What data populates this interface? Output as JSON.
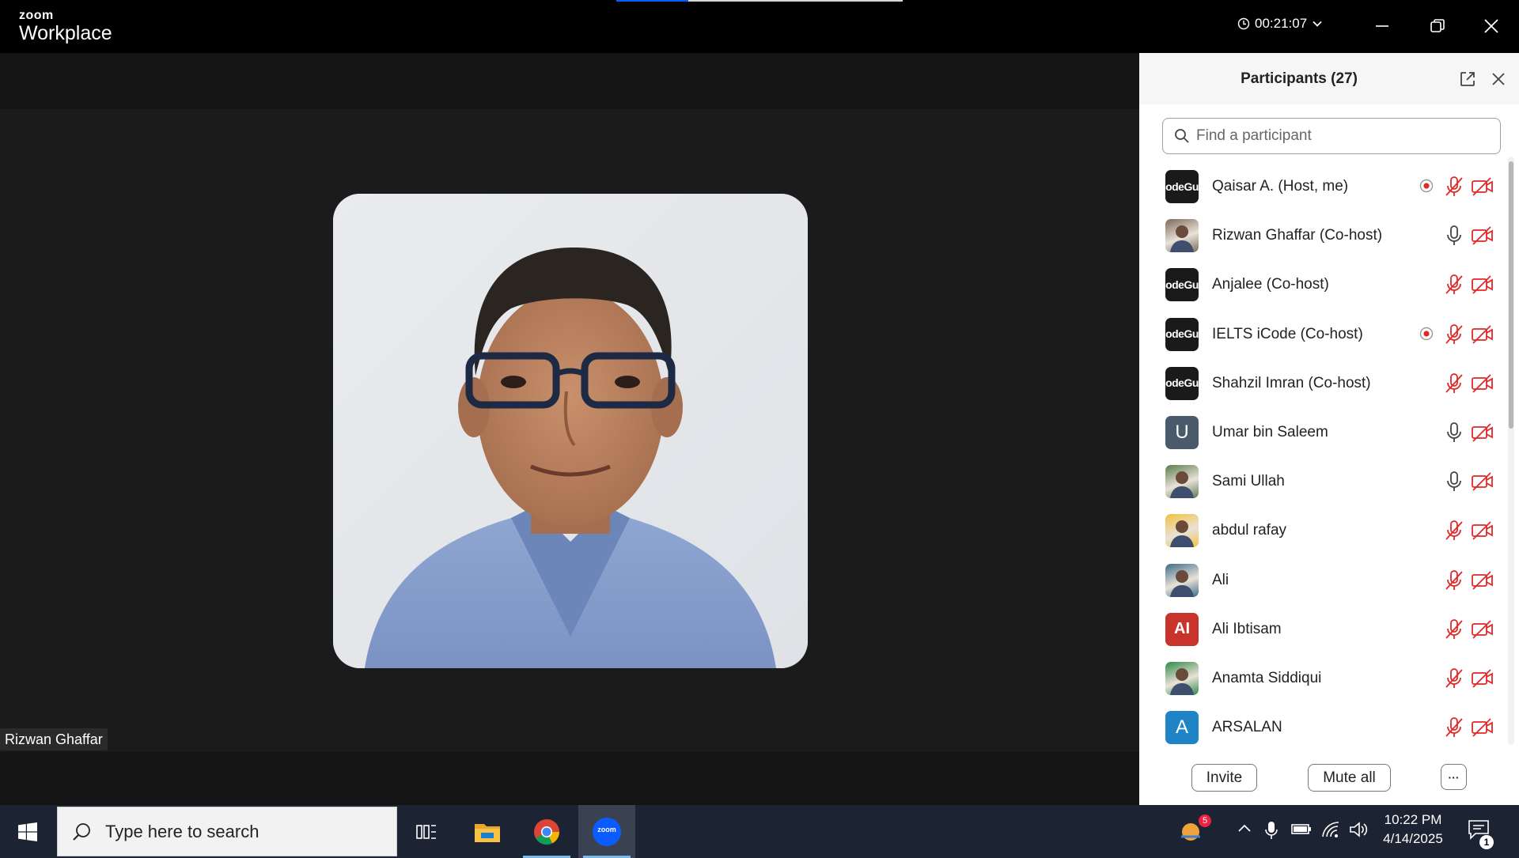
{
  "titlebar": {
    "brand_small": "zoom",
    "brand_big": "Workplace",
    "timer": "00:21:07",
    "share_progress": 0.25,
    "icons": [
      "clock-icon",
      "chevron-down-icon",
      "minimize-icon",
      "restore-icon",
      "close-icon"
    ]
  },
  "video": {
    "active_speaker": "Rizwan Ghaffar"
  },
  "panel": {
    "title": "Participants (27)",
    "search_placeholder": "Find a participant",
    "participants": [
      {
        "name": "Qaisar A. (Host, me)",
        "avatar": "codeguru",
        "recording": true,
        "mic": "muted",
        "camera": "off"
      },
      {
        "name": "Rizwan Ghaffar (Co-host)",
        "avatar": "photo",
        "recording": false,
        "mic": "on",
        "camera": "off"
      },
      {
        "name": "Anjalee (Co-host)",
        "avatar": "codeguru",
        "recording": false,
        "mic": "muted",
        "camera": "off"
      },
      {
        "name": "IELTS iCode (Co-host)",
        "avatar": "codeguru",
        "recording": true,
        "mic": "muted",
        "camera": "off"
      },
      {
        "name": "Shahzil Imran (Co-host)",
        "avatar": "codeguru",
        "recording": false,
        "mic": "muted",
        "camera": "off"
      },
      {
        "name": "Umar bin Saleem",
        "avatar": "U",
        "avatar_color": "#4a5a6a",
        "recording": false,
        "mic": "on",
        "camera": "off"
      },
      {
        "name": "Sami Ullah",
        "avatar": "photo",
        "recording": false,
        "mic": "on",
        "camera": "off"
      },
      {
        "name": "abdul rafay",
        "avatar": "photo",
        "recording": false,
        "mic": "muted",
        "camera": "off"
      },
      {
        "name": "Ali",
        "avatar": "photo",
        "recording": false,
        "mic": "muted",
        "camera": "off"
      },
      {
        "name": "Ali Ibtisam",
        "avatar": "AI",
        "avatar_color": "#c8342b",
        "recording": false,
        "mic": "muted",
        "camera": "off"
      },
      {
        "name": "Anamta Siddiqui",
        "avatar": "photo",
        "recording": false,
        "mic": "muted",
        "camera": "off"
      },
      {
        "name": "ARSALAN",
        "avatar": "A",
        "avatar_color": "#1f84c6",
        "recording": false,
        "mic": "muted",
        "camera": "off"
      }
    ],
    "avatar_text": {
      "codeguru_line1": "iCode",
      "codeguru_line2": "Guru"
    },
    "invite_label": "Invite",
    "mute_all_label": "Mute all",
    "more_label": "···"
  },
  "taskbar": {
    "search_placeholder": "Type here to search",
    "apps": [
      "task-view-icon",
      "file-explorer-icon",
      "chrome-icon",
      "zoom-icon"
    ],
    "active_app": "Zoom",
    "zoom_label": "zoom",
    "weather_badge": "5",
    "time": "10:22 PM",
    "date": "4/14/2025",
    "notifications": "1"
  },
  "colors": {
    "accent": "#0b5cff",
    "muted_red": "#e02828",
    "panel_bg": "#ffffff",
    "taskbar_bg": "#1c2333"
  }
}
